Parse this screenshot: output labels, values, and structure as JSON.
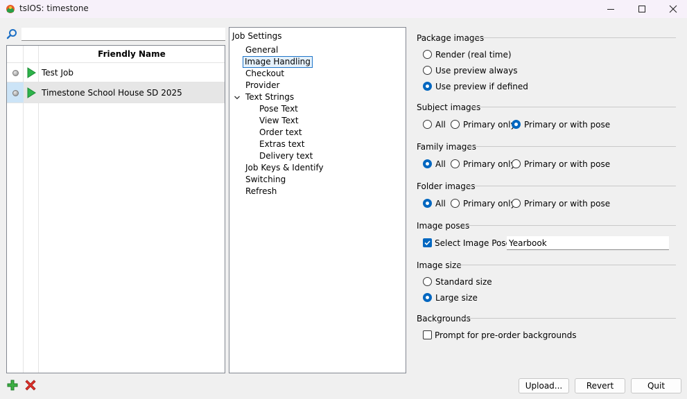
{
  "window": {
    "title": "tsIOS: timestone"
  },
  "search": {
    "value": "",
    "placeholder": ""
  },
  "job_list": {
    "column_header": "Friendly Name",
    "rows": [
      {
        "name": "Test Job",
        "selected": false
      },
      {
        "name": "Timestone School House SD 2025",
        "selected": true
      }
    ]
  },
  "tree": {
    "root": "Job Settings",
    "items": [
      {
        "label": "General"
      },
      {
        "label": "Image Handling",
        "selected": true
      },
      {
        "label": "Checkout"
      },
      {
        "label": "Provider"
      },
      {
        "label": "Text Strings",
        "expanded": true
      },
      {
        "label": "Pose Text"
      },
      {
        "label": "View Text"
      },
      {
        "label": "Order text"
      },
      {
        "label": "Extras text"
      },
      {
        "label": "Delivery text"
      },
      {
        "label": "Job Keys & Identify"
      },
      {
        "label": "Switching"
      },
      {
        "label": "Refresh"
      }
    ]
  },
  "settings": {
    "package_images": {
      "title": "Package images",
      "options": [
        "Render (real time)",
        "Use preview always",
        "Use preview if defined"
      ],
      "selected": "Use preview if defined"
    },
    "subject_images": {
      "title": "Subject images",
      "options": [
        "All",
        "Primary only",
        "Primary or with pose"
      ],
      "selected": "Primary or with pose"
    },
    "family_images": {
      "title": "Family images",
      "options": [
        "All",
        "Primary only",
        "Primary or with pose"
      ],
      "selected": "All"
    },
    "folder_images": {
      "title": "Folder images",
      "options": [
        "All",
        "Primary only",
        "Primary or with pose"
      ],
      "selected": "All"
    },
    "image_poses": {
      "title": "Image poses",
      "checkbox_label": "Select Image Pose:",
      "checked": true,
      "pose_value": "Yearbook"
    },
    "image_size": {
      "title": "Image size",
      "options": [
        "Standard size",
        "Large size"
      ],
      "selected": "Large size"
    },
    "backgrounds": {
      "title": "Backgrounds",
      "checkbox_label": "Prompt for pre-order backgrounds",
      "checked": false
    }
  },
  "buttons": {
    "upload": "Upload...",
    "revert": "Revert",
    "quit": "Quit"
  },
  "colors": {
    "accent": "#0067c0",
    "selection": "#cce4f7",
    "play_green": "#2db34a",
    "delete_red": "#e0302a"
  }
}
